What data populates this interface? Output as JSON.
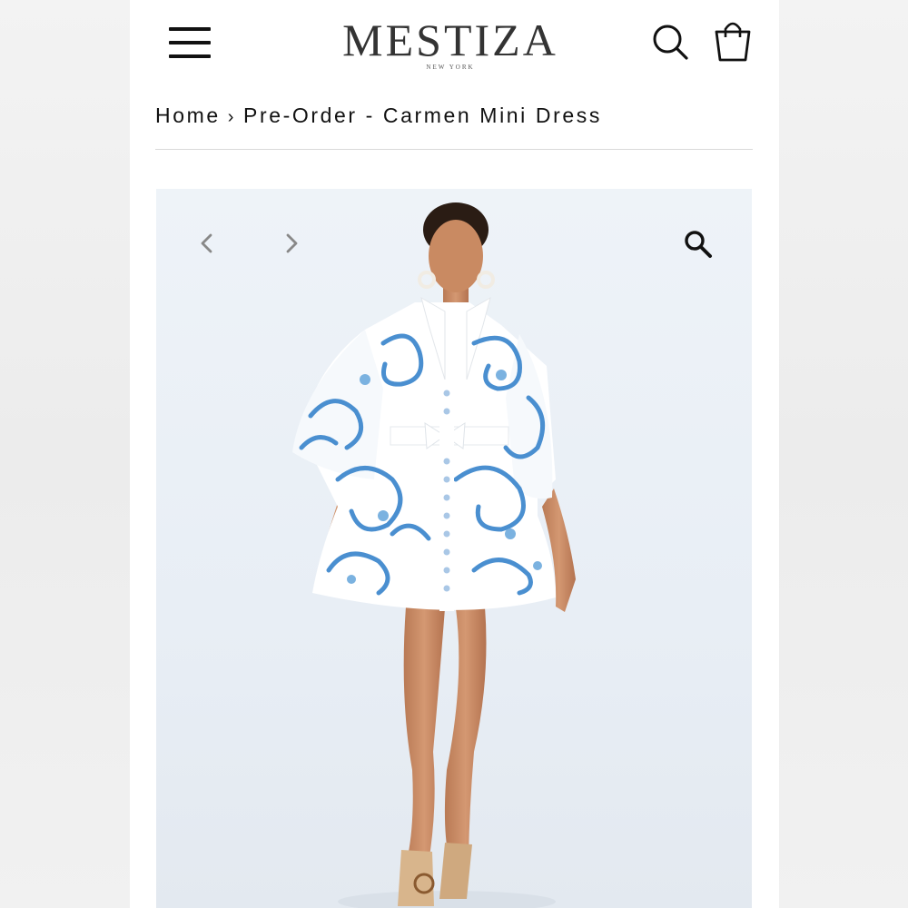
{
  "header": {
    "brand_name": "MESTIZA",
    "brand_sub": "NEW YORK",
    "icons": {
      "menu": "hamburger-menu-icon",
      "search": "search-icon",
      "cart": "shopping-bag-icon"
    }
  },
  "breadcrumb": {
    "home_label": "Home",
    "separator": "›",
    "current_label": "Pre-Order - Carmen Mini Dress"
  },
  "gallery": {
    "prev_icon": "chevron-left-icon",
    "next_icon": "chevron-right-icon",
    "zoom_icon": "zoom-in-icon",
    "image_subject": "model wearing blue and white printed mini dress",
    "colors": {
      "print_blue": "#4a8fd0",
      "dress_white": "#ffffff",
      "background": "#eaf0f6"
    }
  }
}
